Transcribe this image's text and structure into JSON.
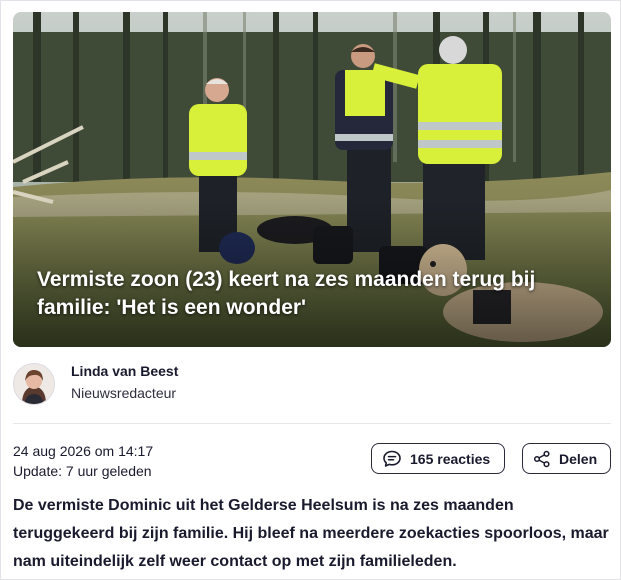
{
  "article": {
    "title": "Vermiste zoon (23) keert na zes maanden terug bij familie: 'Het is een wonder'",
    "body": "De vermiste Dominic uit het Gelderse Heelsum is na zes maanden teruggekeerd bij zijn familie. Hij bleef na meerdere zoekacties spoorloos, maar nam uiteindelijk zelf weer contact op met zijn familieleden."
  },
  "author": {
    "name": "Linda van Beest",
    "role": "Nieuwsredacteur"
  },
  "meta": {
    "published": "24 aug 2026 om 14:17",
    "updated": "Update: 7 uur geleden"
  },
  "actions": {
    "reactions_label": "165 reacties",
    "share_label": "Delen",
    "reactions_icon": "comment-icon",
    "share_icon": "share-icon"
  },
  "colors": {
    "text": "#1a1a2e",
    "border": "#2a2a3a",
    "vest": "#d8f03a"
  }
}
